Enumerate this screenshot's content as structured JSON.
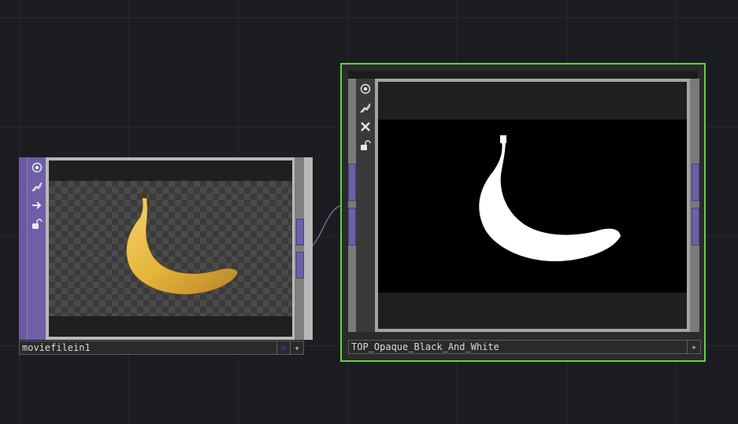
{
  "nodes": [
    {
      "name": "moviefilein1"
    },
    {
      "name": "TOP_Opaque_Black_And_White"
    }
  ],
  "icons": {
    "node1": [
      "viewer-toggle-icon",
      "bypass-icon",
      "arrow-right-icon",
      "lock-icon"
    ],
    "node2": [
      "viewer-toggle-icon",
      "bypass-icon",
      "close-icon",
      "lock-icon"
    ]
  },
  "colors": {
    "background": "#1c1d20",
    "node1_accent": "#6e5fa6",
    "selected_border": "#5fd14a"
  }
}
